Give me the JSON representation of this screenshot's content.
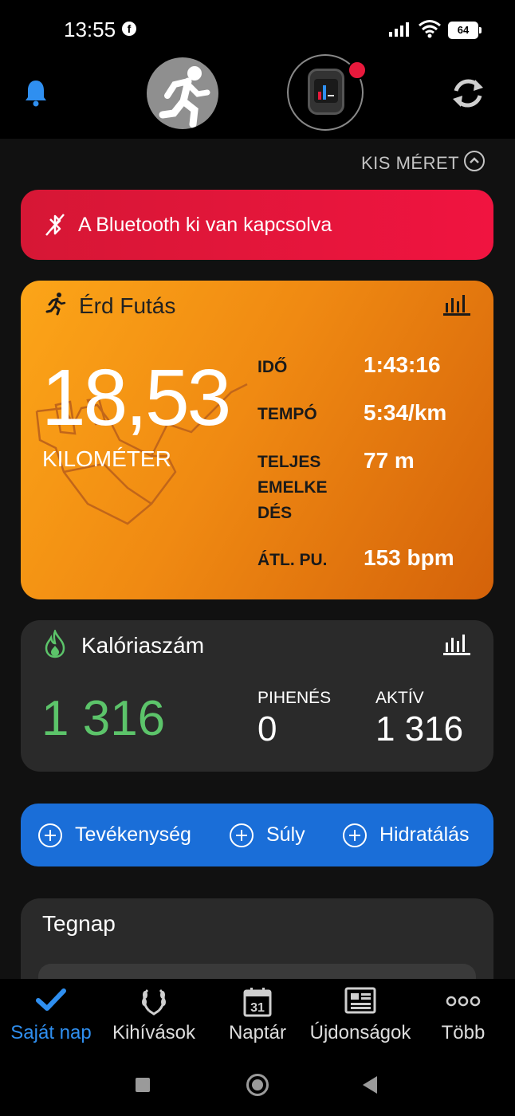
{
  "status_bar": {
    "time": "13:55",
    "battery": "64"
  },
  "header": {
    "collapse_label": "KIS MÉRET"
  },
  "bluetooth_banner": {
    "text": "A Bluetooth ki van kapcsolva"
  },
  "activity": {
    "title": "Érd Futás",
    "distance": "18,53",
    "distance_unit": "KILOMÉTER",
    "stats": [
      {
        "label": "IDŐ",
        "value": "1:43:16"
      },
      {
        "label": "TEMPÓ",
        "value": "5:34/km"
      },
      {
        "label": "TELJES EMELKE DÉS",
        "value": "77 m"
      },
      {
        "label": "ÁTL. PU.",
        "value": "153 bpm"
      }
    ]
  },
  "calories": {
    "title": "Kalóriaszám",
    "total": "1 316",
    "resting_label": "PIHENÉS",
    "resting_value": "0",
    "active_label": "AKTÍV",
    "active_value": "1 316"
  },
  "quick_add": [
    {
      "label": "Tevékenység"
    },
    {
      "label": "Súly"
    },
    {
      "label": "Hidratálás"
    }
  ],
  "yesterday": {
    "title": "Tegnap"
  },
  "bottom_nav": [
    {
      "label": "Saját nap",
      "icon": "check-icon",
      "active": true
    },
    {
      "label": "Kihívások",
      "icon": "laurel-icon",
      "active": false
    },
    {
      "label": "Naptár",
      "icon": "calendar-icon",
      "active": false,
      "badge": "31"
    },
    {
      "label": "Újdonságok",
      "icon": "news-icon",
      "active": false
    },
    {
      "label": "Több",
      "icon": "more-icon",
      "active": false
    }
  ],
  "colors": {
    "accent_blue": "#1a6ed8",
    "alert_red": "#e8193c",
    "activity_orange": "#f08a12",
    "calorie_green": "#5cc46a"
  }
}
